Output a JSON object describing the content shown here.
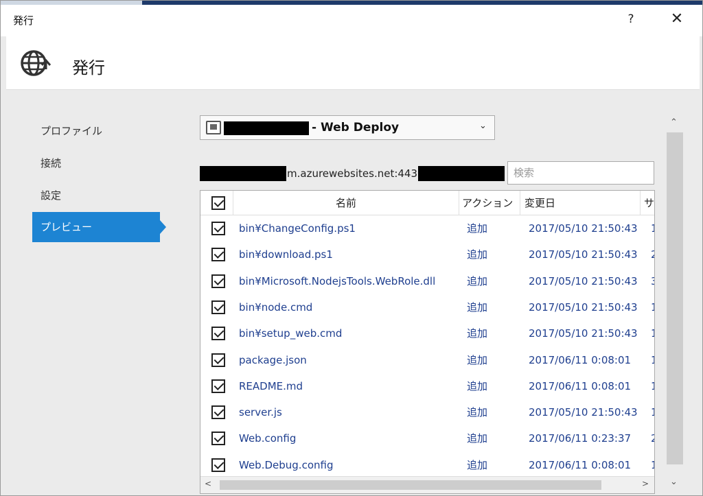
{
  "window": {
    "title": "発行",
    "help_label": "?",
    "close_label": "✕"
  },
  "header": {
    "title": "発行",
    "icon": "globe-publish-icon"
  },
  "sidebar": {
    "items": [
      {
        "label": "プロファイル",
        "active": false
      },
      {
        "label": "接続",
        "active": false
      },
      {
        "label": "設定",
        "active": false
      },
      {
        "label": "プレビュー",
        "active": true
      }
    ]
  },
  "profile": {
    "label": "- Web Deploy",
    "dropdown_icon": "chevron-down-icon"
  },
  "connection": {
    "url_text": "m.azurewebsites.net:443:"
  },
  "search": {
    "placeholder": "検索",
    "value": ""
  },
  "table": {
    "columns": [
      "名前",
      "アクション",
      "変更日",
      "サ"
    ],
    "header_checked": true,
    "rows": [
      {
        "checked": true,
        "name": "bin¥ChangeConfig.ps1",
        "action": "追加",
        "date": "2017/05/10 21:50:43",
        "size": "1"
      },
      {
        "checked": true,
        "name": "bin¥download.ps1",
        "action": "追加",
        "date": "2017/05/10 21:50:43",
        "size": "2"
      },
      {
        "checked": true,
        "name": "bin¥Microsoft.NodejsTools.WebRole.dll",
        "action": "追加",
        "date": "2017/05/10 21:50:43",
        "size": "3"
      },
      {
        "checked": true,
        "name": "bin¥node.cmd",
        "action": "追加",
        "date": "2017/05/10 21:50:43",
        "size": "1"
      },
      {
        "checked": true,
        "name": "bin¥setup_web.cmd",
        "action": "追加",
        "date": "2017/05/10 21:50:43",
        "size": "1"
      },
      {
        "checked": true,
        "name": "package.json",
        "action": "追加",
        "date": "2017/06/11 0:08:01",
        "size": "1"
      },
      {
        "checked": true,
        "name": "README.md",
        "action": "追加",
        "date": "2017/06/11 0:08:01",
        "size": "1"
      },
      {
        "checked": true,
        "name": "server.js",
        "action": "追加",
        "date": "2017/05/10 21:50:43",
        "size": "1"
      },
      {
        "checked": true,
        "name": "Web.config",
        "action": "追加",
        "date": "2017/06/11 0:23:37",
        "size": "2"
      },
      {
        "checked": true,
        "name": "Web.Debug.config",
        "action": "追加",
        "date": "2017/06/11 0:08:01",
        "size": "1"
      }
    ]
  },
  "colors": {
    "accent": "#1d84d3",
    "link_text": "#1f3f8f",
    "redaction": "#000000"
  }
}
